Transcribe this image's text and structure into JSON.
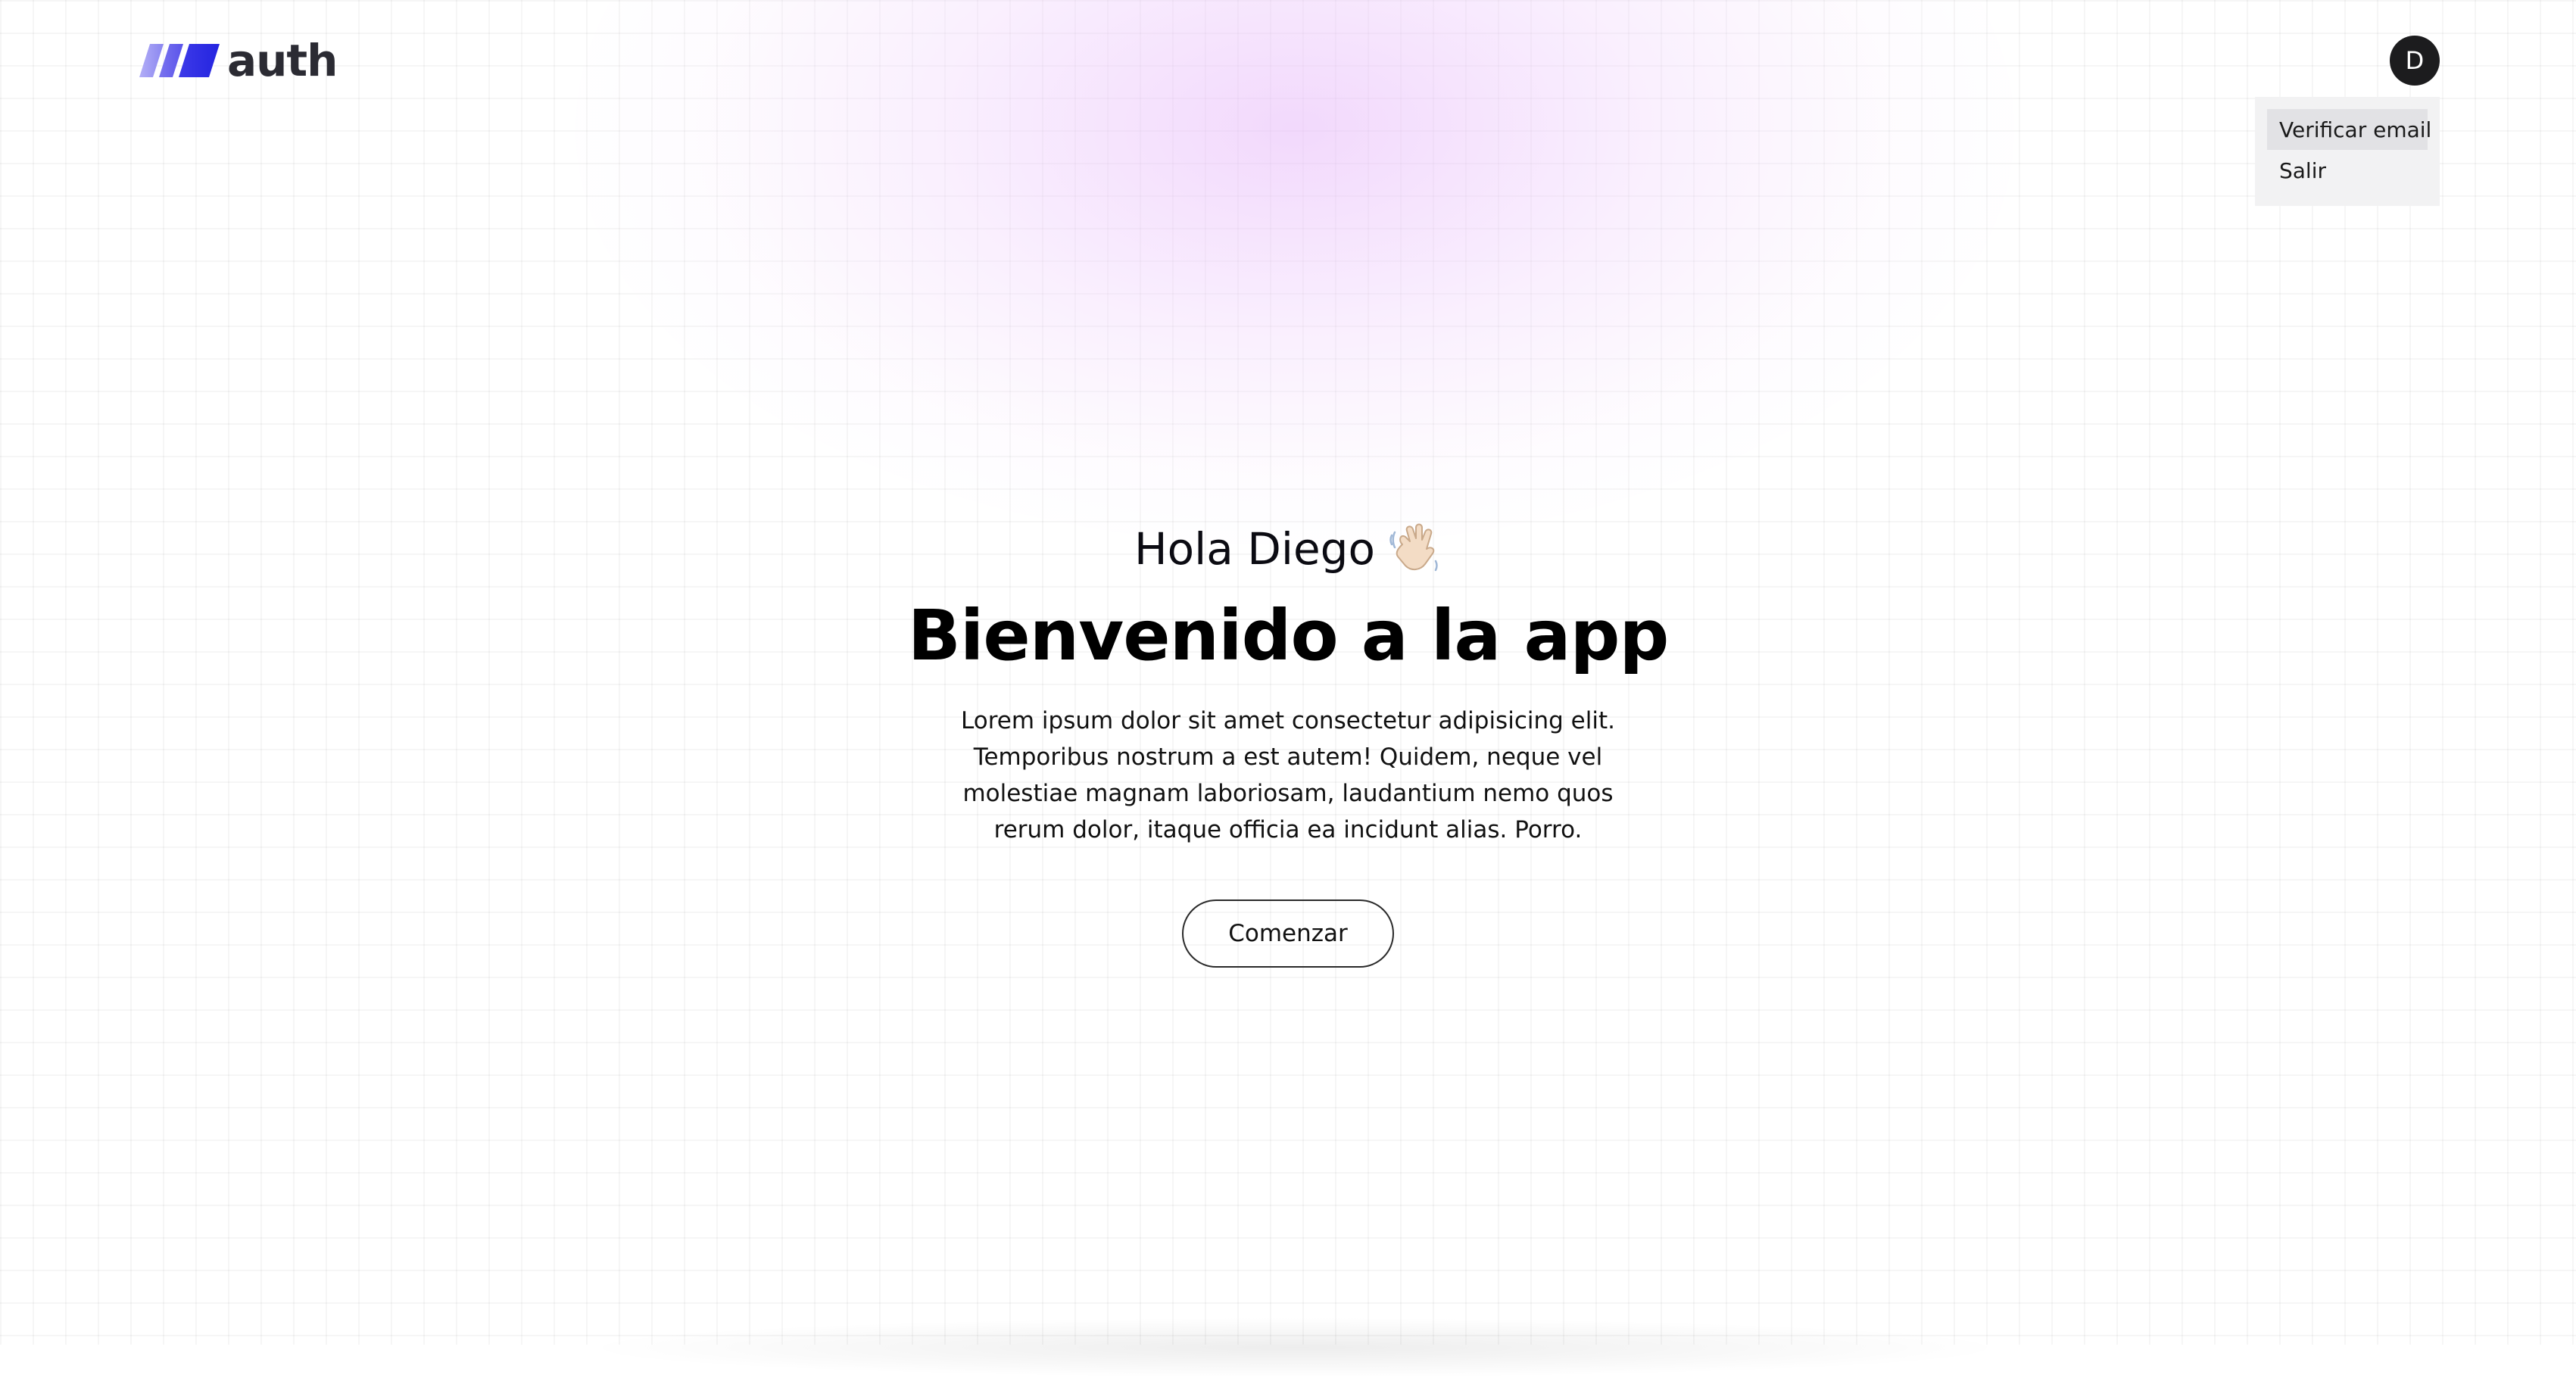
{
  "header": {
    "logo_text": "auth",
    "avatar_initial": "D"
  },
  "user_menu": {
    "items": [
      {
        "label": "Verificar email",
        "highlighted": true
      },
      {
        "label": "Salir",
        "highlighted": false
      }
    ]
  },
  "hero": {
    "greeting": "Hola Diego",
    "greeting_icon": "waving-hand-icon",
    "headline": "Bienvenido a la app",
    "description": "Lorem ipsum dolor sit amet consectetur adipisicing elit. Temporibus nostrum a est autem! Quidem, neque vel molestiae magnam laboriosam, laudantium nemo quos rerum dolor, itaque officia ea incidunt alias. Porro.",
    "cta_label": "Comenzar"
  },
  "colors": {
    "logo_gradient_start": "#a5a0f5",
    "logo_gradient_end": "#2f2fe8",
    "glow": "#e7b9fa",
    "avatar_bg": "#1c1c1e",
    "menu_bg": "#f2f2f3",
    "menu_active_bg": "#e2e2e5"
  }
}
